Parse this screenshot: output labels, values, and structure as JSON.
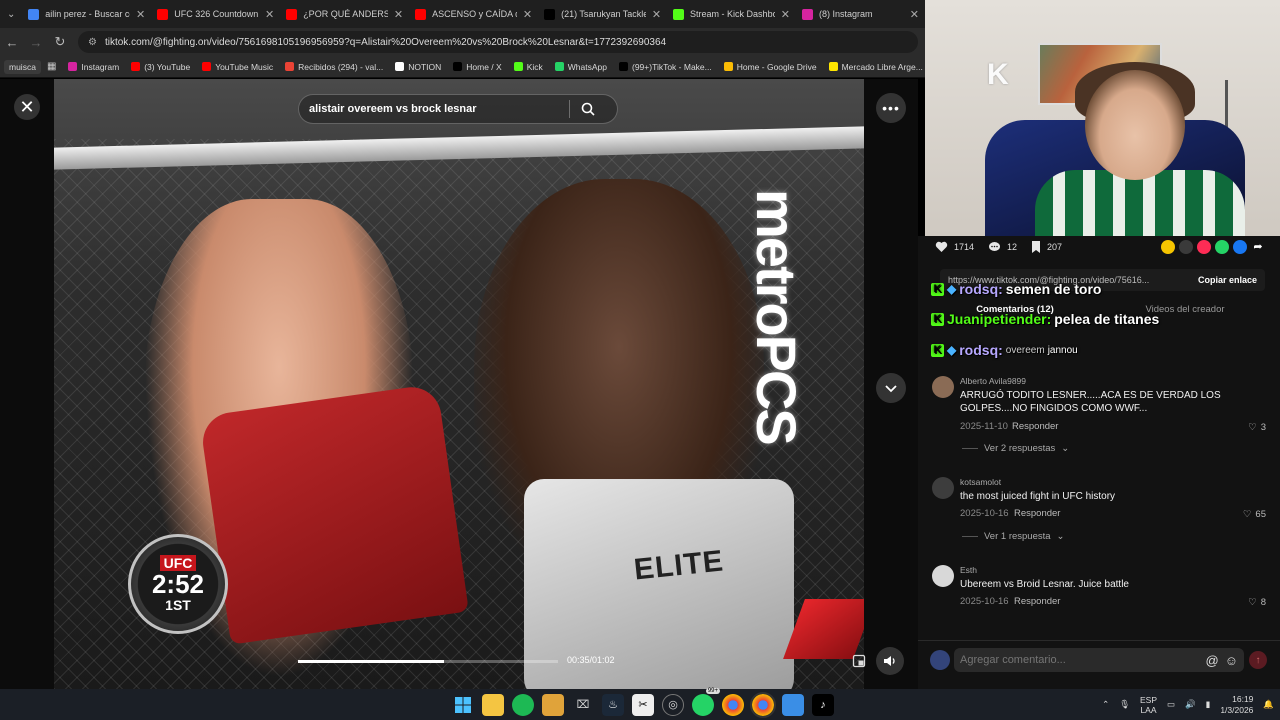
{
  "browser": {
    "tabs": [
      {
        "title": "ailin perez - Buscar con Google",
        "color": "#4285f4"
      },
      {
        "title": "UFC 326 Countdown - Full",
        "color": "#ff0000"
      },
      {
        "title": "¿POR QUÉ ANDERSON SI",
        "color": "#ff0000"
      },
      {
        "title": "ASCENSO y CAÍDA del M",
        "color": "#ff0000"
      },
      {
        "title": "(21) Tsarukyan Tackles Po",
        "color": "#000000"
      },
      {
        "title": "Stream - Kick Dashboard",
        "color": "#53fc18"
      },
      {
        "title": "(8) Instagram",
        "color": "#d6249f"
      }
    ],
    "url": "tiktok.com/@fighting.on/video/7561698105196956959?q=Alistair%20Overeem%20vs%20Brock%20Lesnar&t=1772392690364",
    "bookmarks": [
      {
        "label": "muisca",
        "color": "#333"
      },
      {
        "label": "",
        "color": "#888"
      },
      {
        "label": "Instagram",
        "color": "#d6249f"
      },
      {
        "label": "(3) YouTube",
        "color": "#ff0000"
      },
      {
        "label": "YouTube Music",
        "color": "#ff0000"
      },
      {
        "label": "Recibidos (294) - val...",
        "color": "#ea4335"
      },
      {
        "label": "NOTION",
        "color": "#ffffff"
      },
      {
        "label": "Home / X",
        "color": "#000"
      },
      {
        "label": "Kick",
        "color": "#53fc18"
      },
      {
        "label": "WhatsApp",
        "color": "#25d366"
      },
      {
        "label": "(99+)TikTok - Make...",
        "color": "#000"
      },
      {
        "label": "Home - Google Drive",
        "color": "#fbbc04"
      },
      {
        "label": "Mercado Libre Arge...",
        "color": "#ffe600"
      }
    ]
  },
  "player": {
    "search_value": "alistair overeem vs brock lesnar",
    "timecode": "00:35/01:02",
    "progress": 0.56,
    "ufc_brand": "UFC",
    "ufc_clock": "2:52",
    "ufc_round": "1ST",
    "sponsor": "metroPCS",
    "shorts_text": "ELITE"
  },
  "actions": {
    "likes": "1714",
    "comments": "12",
    "saves": "207"
  },
  "link_row": {
    "url": "https://www.tiktok.com/@fighting.on/video/75616...",
    "copy_label": "Copiar enlace"
  },
  "comment_tabs": {
    "comments": "Comentarios (12)",
    "creator_videos": "Videos del creador"
  },
  "chat": [
    {
      "user": "rodsq:",
      "message": "semen de toro"
    },
    {
      "user": "Juanipetiender:",
      "message": "pelea de titanes"
    },
    {
      "user": "rodsq:",
      "message": "jannou"
    }
  ],
  "partial_text": "overeem",
  "comments": [
    {
      "user": "Alberto Avila9899",
      "text": "ARRUGÓ TODITO LESNER.....ACA ES DE VERDAD LOS GOLPES....NO FINGIDOS COMO WWF...",
      "date": "2025-11-10",
      "reply": "Responder",
      "likes": "3",
      "view_replies": "Ver 2 respuestas"
    },
    {
      "user": "kotsamolot",
      "text": "the most juiced fight in UFC history",
      "date": "2025-10-16",
      "reply": "Responder",
      "likes": "65",
      "view_replies": "Ver 1 respuesta"
    },
    {
      "user": "Esth",
      "text": "Ubereem vs Broid Lesnar. Juice battle",
      "date": "2025-10-16",
      "reply": "Responder",
      "likes": "8"
    }
  ],
  "comment_input": {
    "placeholder": "Agregar comentario..."
  },
  "taskbar": {
    "lang_top": "ESP",
    "lang_bottom": "LAA",
    "time": "16:19",
    "date": "1/3/2026",
    "badge": "99+"
  }
}
